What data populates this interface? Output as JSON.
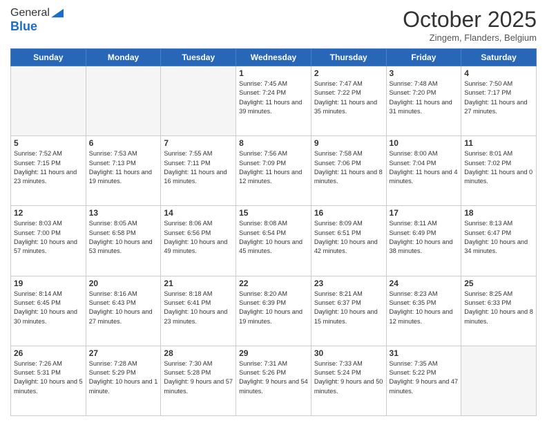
{
  "header": {
    "logo_general": "General",
    "logo_blue": "Blue",
    "month": "October 2025",
    "location": "Zingem, Flanders, Belgium"
  },
  "weekdays": [
    "Sunday",
    "Monday",
    "Tuesday",
    "Wednesday",
    "Thursday",
    "Friday",
    "Saturday"
  ],
  "weeks": [
    [
      {
        "day": "",
        "empty": true
      },
      {
        "day": "",
        "empty": true
      },
      {
        "day": "",
        "empty": true
      },
      {
        "day": "1",
        "sunrise": "Sunrise: 7:45 AM",
        "sunset": "Sunset: 7:24 PM",
        "daylight": "Daylight: 11 hours and 39 minutes."
      },
      {
        "day": "2",
        "sunrise": "Sunrise: 7:47 AM",
        "sunset": "Sunset: 7:22 PM",
        "daylight": "Daylight: 11 hours and 35 minutes."
      },
      {
        "day": "3",
        "sunrise": "Sunrise: 7:48 AM",
        "sunset": "Sunset: 7:20 PM",
        "daylight": "Daylight: 11 hours and 31 minutes."
      },
      {
        "day": "4",
        "sunrise": "Sunrise: 7:50 AM",
        "sunset": "Sunset: 7:17 PM",
        "daylight": "Daylight: 11 hours and 27 minutes."
      }
    ],
    [
      {
        "day": "5",
        "sunrise": "Sunrise: 7:52 AM",
        "sunset": "Sunset: 7:15 PM",
        "daylight": "Daylight: 11 hours and 23 minutes."
      },
      {
        "day": "6",
        "sunrise": "Sunrise: 7:53 AM",
        "sunset": "Sunset: 7:13 PM",
        "daylight": "Daylight: 11 hours and 19 minutes."
      },
      {
        "day": "7",
        "sunrise": "Sunrise: 7:55 AM",
        "sunset": "Sunset: 7:11 PM",
        "daylight": "Daylight: 11 hours and 16 minutes."
      },
      {
        "day": "8",
        "sunrise": "Sunrise: 7:56 AM",
        "sunset": "Sunset: 7:09 PM",
        "daylight": "Daylight: 11 hours and 12 minutes."
      },
      {
        "day": "9",
        "sunrise": "Sunrise: 7:58 AM",
        "sunset": "Sunset: 7:06 PM",
        "daylight": "Daylight: 11 hours and 8 minutes."
      },
      {
        "day": "10",
        "sunrise": "Sunrise: 8:00 AM",
        "sunset": "Sunset: 7:04 PM",
        "daylight": "Daylight: 11 hours and 4 minutes."
      },
      {
        "day": "11",
        "sunrise": "Sunrise: 8:01 AM",
        "sunset": "Sunset: 7:02 PM",
        "daylight": "Daylight: 11 hours and 0 minutes."
      }
    ],
    [
      {
        "day": "12",
        "sunrise": "Sunrise: 8:03 AM",
        "sunset": "Sunset: 7:00 PM",
        "daylight": "Daylight: 10 hours and 57 minutes."
      },
      {
        "day": "13",
        "sunrise": "Sunrise: 8:05 AM",
        "sunset": "Sunset: 6:58 PM",
        "daylight": "Daylight: 10 hours and 53 minutes."
      },
      {
        "day": "14",
        "sunrise": "Sunrise: 8:06 AM",
        "sunset": "Sunset: 6:56 PM",
        "daylight": "Daylight: 10 hours and 49 minutes."
      },
      {
        "day": "15",
        "sunrise": "Sunrise: 8:08 AM",
        "sunset": "Sunset: 6:54 PM",
        "daylight": "Daylight: 10 hours and 45 minutes."
      },
      {
        "day": "16",
        "sunrise": "Sunrise: 8:09 AM",
        "sunset": "Sunset: 6:51 PM",
        "daylight": "Daylight: 10 hours and 42 minutes."
      },
      {
        "day": "17",
        "sunrise": "Sunrise: 8:11 AM",
        "sunset": "Sunset: 6:49 PM",
        "daylight": "Daylight: 10 hours and 38 minutes."
      },
      {
        "day": "18",
        "sunrise": "Sunrise: 8:13 AM",
        "sunset": "Sunset: 6:47 PM",
        "daylight": "Daylight: 10 hours and 34 minutes."
      }
    ],
    [
      {
        "day": "19",
        "sunrise": "Sunrise: 8:14 AM",
        "sunset": "Sunset: 6:45 PM",
        "daylight": "Daylight: 10 hours and 30 minutes."
      },
      {
        "day": "20",
        "sunrise": "Sunrise: 8:16 AM",
        "sunset": "Sunset: 6:43 PM",
        "daylight": "Daylight: 10 hours and 27 minutes."
      },
      {
        "day": "21",
        "sunrise": "Sunrise: 8:18 AM",
        "sunset": "Sunset: 6:41 PM",
        "daylight": "Daylight: 10 hours and 23 minutes."
      },
      {
        "day": "22",
        "sunrise": "Sunrise: 8:20 AM",
        "sunset": "Sunset: 6:39 PM",
        "daylight": "Daylight: 10 hours and 19 minutes."
      },
      {
        "day": "23",
        "sunrise": "Sunrise: 8:21 AM",
        "sunset": "Sunset: 6:37 PM",
        "daylight": "Daylight: 10 hours and 15 minutes."
      },
      {
        "day": "24",
        "sunrise": "Sunrise: 8:23 AM",
        "sunset": "Sunset: 6:35 PM",
        "daylight": "Daylight: 10 hours and 12 minutes."
      },
      {
        "day": "25",
        "sunrise": "Sunrise: 8:25 AM",
        "sunset": "Sunset: 6:33 PM",
        "daylight": "Daylight: 10 hours and 8 minutes."
      }
    ],
    [
      {
        "day": "26",
        "sunrise": "Sunrise: 7:26 AM",
        "sunset": "Sunset: 5:31 PM",
        "daylight": "Daylight: 10 hours and 5 minutes."
      },
      {
        "day": "27",
        "sunrise": "Sunrise: 7:28 AM",
        "sunset": "Sunset: 5:29 PM",
        "daylight": "Daylight: 10 hours and 1 minute."
      },
      {
        "day": "28",
        "sunrise": "Sunrise: 7:30 AM",
        "sunset": "Sunset: 5:28 PM",
        "daylight": "Daylight: 9 hours and 57 minutes."
      },
      {
        "day": "29",
        "sunrise": "Sunrise: 7:31 AM",
        "sunset": "Sunset: 5:26 PM",
        "daylight": "Daylight: 9 hours and 54 minutes."
      },
      {
        "day": "30",
        "sunrise": "Sunrise: 7:33 AM",
        "sunset": "Sunset: 5:24 PM",
        "daylight": "Daylight: 9 hours and 50 minutes."
      },
      {
        "day": "31",
        "sunrise": "Sunrise: 7:35 AM",
        "sunset": "Sunset: 5:22 PM",
        "daylight": "Daylight: 9 hours and 47 minutes."
      },
      {
        "day": "",
        "empty": true
      }
    ]
  ]
}
